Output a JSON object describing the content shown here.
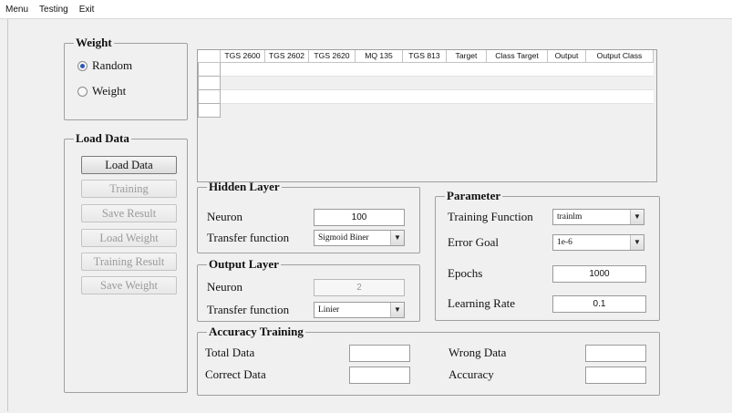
{
  "menubar": {
    "items": [
      "Menu",
      "Testing",
      "Exit"
    ]
  },
  "weight": {
    "legend": "Weight",
    "random_label": "Random",
    "weight_label": "Weight",
    "selected": "Random"
  },
  "load_data": {
    "legend": "Load Data",
    "buttons": [
      "Load Data",
      "Training",
      "Save Result",
      "Load Weight",
      "Training Result",
      "Save Weight"
    ]
  },
  "table": {
    "columns": [
      "TGS 2600",
      "TGS 2602",
      "TGS 2620",
      "MQ 135",
      "TGS 813",
      "Target",
      "Class Target",
      "Output",
      "Output Class"
    ]
  },
  "hidden_layer": {
    "legend": "Hidden Layer",
    "neuron_label": "Neuron",
    "neuron_value": "100",
    "transfer_label": "Transfer function",
    "transfer_value": "Sigmoid Biner"
  },
  "output_layer": {
    "legend": "Output Layer",
    "neuron_label": "Neuron",
    "neuron_value": "2",
    "transfer_label": "Transfer function",
    "transfer_value": "Linier"
  },
  "parameter": {
    "legend": "Parameter",
    "training_function_label": "Training Function",
    "training_function_value": "trainlm",
    "error_goal_label": "Error Goal",
    "error_goal_value": "1e-6",
    "epochs_label": "Epochs",
    "epochs_value": "1000",
    "learning_rate_label": "Learning Rate",
    "learning_rate_value": "0.1"
  },
  "accuracy": {
    "legend": "Accuracy Training",
    "total_label": "Total Data",
    "correct_label": "Correct Data",
    "wrong_label": "Wrong Data",
    "accuracy_label": "Accuracy",
    "total_value": "",
    "correct_value": "",
    "wrong_value": "",
    "accuracy_value": ""
  }
}
